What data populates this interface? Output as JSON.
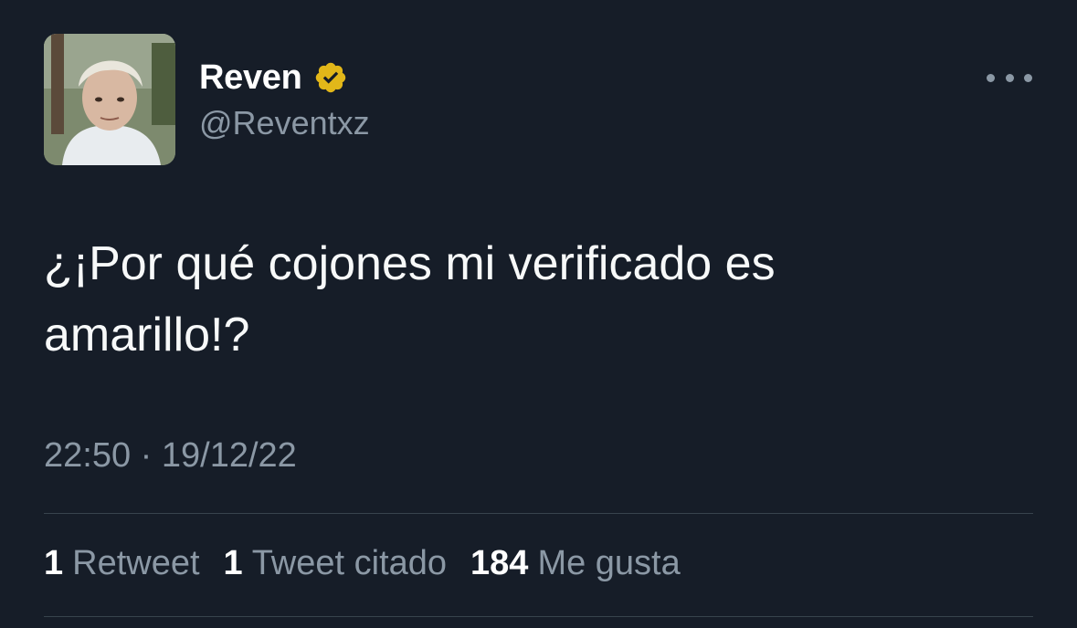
{
  "user": {
    "display_name": "Reven",
    "handle": "@Reventxz",
    "verified_color": "#e2b719"
  },
  "tweet": {
    "text": "¿¡Por qué cojones mi verificado es\namarillo!?",
    "time": "22:50",
    "separator": "·",
    "date": "19/12/22"
  },
  "stats": {
    "retweets_count": "1",
    "retweets_label": "Retweet",
    "quotes_count": "1",
    "quotes_label": "Tweet citado",
    "likes_count": "184",
    "likes_label": "Me gusta"
  },
  "icons": {
    "more": "more-horizontal-icon",
    "verified": "verified-badge-icon"
  }
}
